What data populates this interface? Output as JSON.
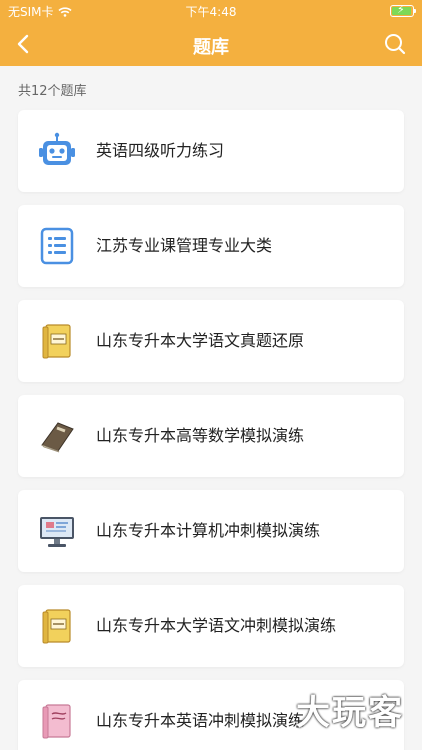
{
  "status_bar": {
    "carrier": "无SIM卡",
    "time": "下午4:48"
  },
  "navbar": {
    "title": "题库"
  },
  "bank_count": "共12个题库",
  "items": [
    {
      "title": "英语四级听力练习",
      "icon": "robot-icon"
    },
    {
      "title": "江苏专业课管理专业大类",
      "icon": "list-document-icon"
    },
    {
      "title": "山东专升本大学语文真题还原",
      "icon": "book-icon"
    },
    {
      "title": "山东专升本高等数学模拟演练",
      "icon": "notebook-icon"
    },
    {
      "title": "山东专升本计算机冲刺模拟演练",
      "icon": "computer-monitor-icon"
    },
    {
      "title": " 山东专升本大学语文冲刺模拟演练",
      "icon": "book-icon"
    },
    {
      "title": "山东专升本英语冲刺模拟演练",
      "icon": "pink-book-icon"
    }
  ],
  "watermark": "大玩客",
  "colors": {
    "accent": "#f4b03f",
    "background": "#f5f5f5",
    "card": "#ffffff",
    "icon_blue": "#4a90e2"
  }
}
